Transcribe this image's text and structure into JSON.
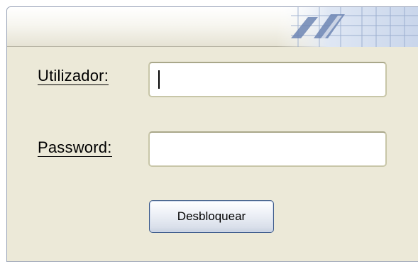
{
  "form": {
    "username": {
      "label_accel": "U",
      "label_rest": "tilizador:",
      "value": ""
    },
    "password": {
      "label_accel": "P",
      "label_rest": "assword:",
      "value": ""
    },
    "unlock_button_label": "Desbloquear"
  },
  "icons": {
    "banner": "grid-banner-graphic"
  },
  "colors": {
    "dialog_background": "#ece9d8",
    "field_border": "#c8c6a8",
    "button_border": "#3c5a8a"
  }
}
